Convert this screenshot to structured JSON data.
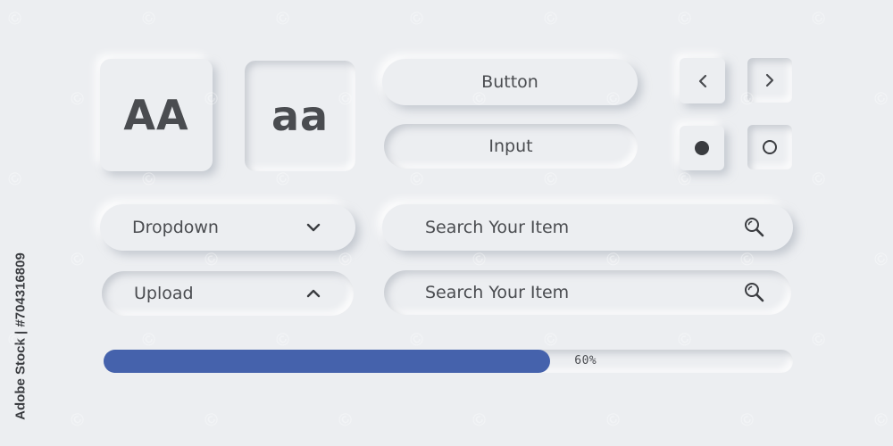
{
  "tiles": {
    "uppercase": "AA",
    "lowercase": "aa"
  },
  "buttons": {
    "button_label": "Button",
    "input_label": "Input"
  },
  "nav": {
    "prev_icon": "chevron-left-icon",
    "next_icon": "chevron-right-icon"
  },
  "radio": {
    "selected_icon": "radio-filled-icon",
    "unselected_icon": "radio-empty-icon"
  },
  "dropdown": {
    "label": "Dropdown",
    "icon": "chevron-down-icon"
  },
  "upload": {
    "label": "Upload",
    "icon": "chevron-up-icon"
  },
  "search": [
    {
      "placeholder": "Search Your Item",
      "icon": "search-icon"
    },
    {
      "placeholder": "Search Your Item",
      "icon": "search-icon"
    }
  ],
  "progress": {
    "value": 0.6,
    "label": "60%",
    "fill_color": "#4562ac"
  },
  "credit": {
    "text": "Adobe Stock | #704316809"
  },
  "colors": {
    "background": "#eceef1",
    "text": "#4a4c50",
    "accent": "#4562ac"
  }
}
